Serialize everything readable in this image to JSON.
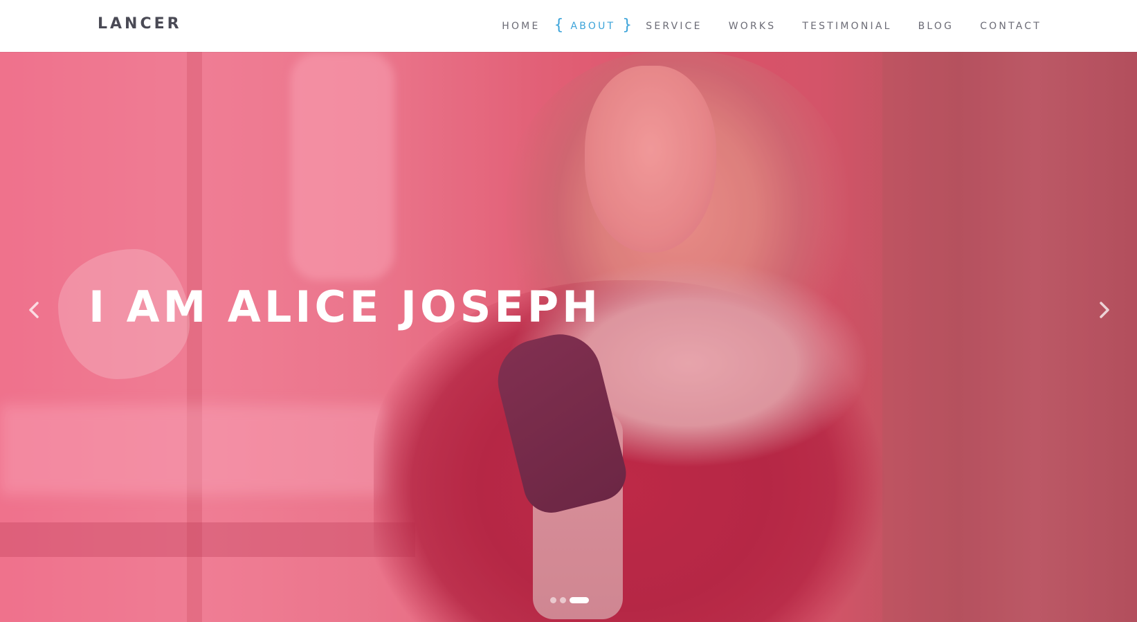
{
  "brand": "LANCER",
  "nav": {
    "items": [
      {
        "label": "HOME"
      },
      {
        "label": "ABOUT"
      },
      {
        "label": "SERVICE"
      },
      {
        "label": "WORKS"
      },
      {
        "label": "TESTIMONIAL"
      },
      {
        "label": "BLOG"
      },
      {
        "label": "CONTACT"
      }
    ],
    "active_index": 1,
    "brace_left": "{",
    "brace_right": "}"
  },
  "hero": {
    "title": "I AM ALICE JOSEPH",
    "prev_icon": "chevron-left-icon",
    "next_icon": "chevron-right-icon",
    "slides_count": 3,
    "active_slide": 3
  },
  "colors": {
    "accent": "#3ba3d9",
    "brand_text": "#4a4a55",
    "nav_text": "#6b6b75",
    "hero_overlay": "#f07a93"
  }
}
